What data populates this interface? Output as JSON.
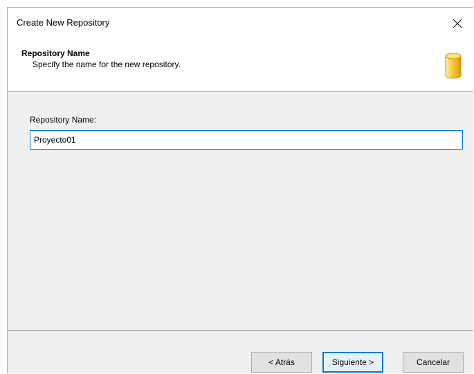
{
  "window": {
    "title": "Create New Repository",
    "close_icon": "close-icon"
  },
  "header": {
    "title": "Repository Name",
    "subtitle": "Specify the name for the new repository.",
    "icon": "database-icon",
    "icon_color": "#f5c518"
  },
  "form": {
    "name_label": "Repository Name:",
    "name_value": "Proyecto01"
  },
  "footer": {
    "back_label": "< Atrás",
    "next_label": "Siguiente >",
    "cancel_label": "Cancelar"
  },
  "colors": {
    "accent": "#0078d7",
    "dialog_bg": "#f0f0f0",
    "panel_bg": "#ffffff"
  }
}
